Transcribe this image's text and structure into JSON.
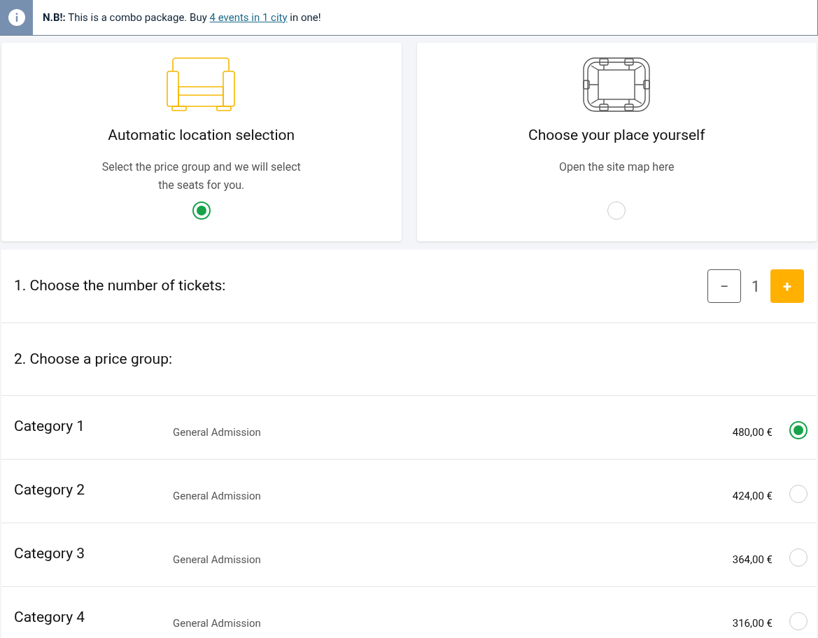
{
  "notice": {
    "text": "**N.B!:** This is a combo package. Buy",
    "link": "4 events in 1 city",
    "text_after": "in one!"
  },
  "modes": [
    {
      "kind": "automatic",
      "title": "Automatic location selection",
      "description": "Select the price group and we will select the seats for you.",
      "selected": true
    },
    {
      "kind": "map",
      "title": "Choose your place yourself",
      "description": "Open the site map here",
      "selected": false
    }
  ],
  "tickets": {
    "label": "1. Choose the number of tickets:",
    "decrement": "−",
    "count": "1",
    "increment": "+"
  },
  "price_group": {
    "label": "2. Choose a price group:"
  },
  "categories": [
    {
      "name": "Category 1",
      "type": "General Admission",
      "price": "480,00 €",
      "selected": true
    },
    {
      "name": "Category 2",
      "type": "General Admission",
      "price": "424,00 €",
      "selected": false
    },
    {
      "name": "Category 3",
      "type": "General Admission",
      "price": "364,00 €",
      "selected": false
    },
    {
      "name": "Category 4",
      "type": "General Admission",
      "price": "316,00 €",
      "selected": false
    }
  ]
}
